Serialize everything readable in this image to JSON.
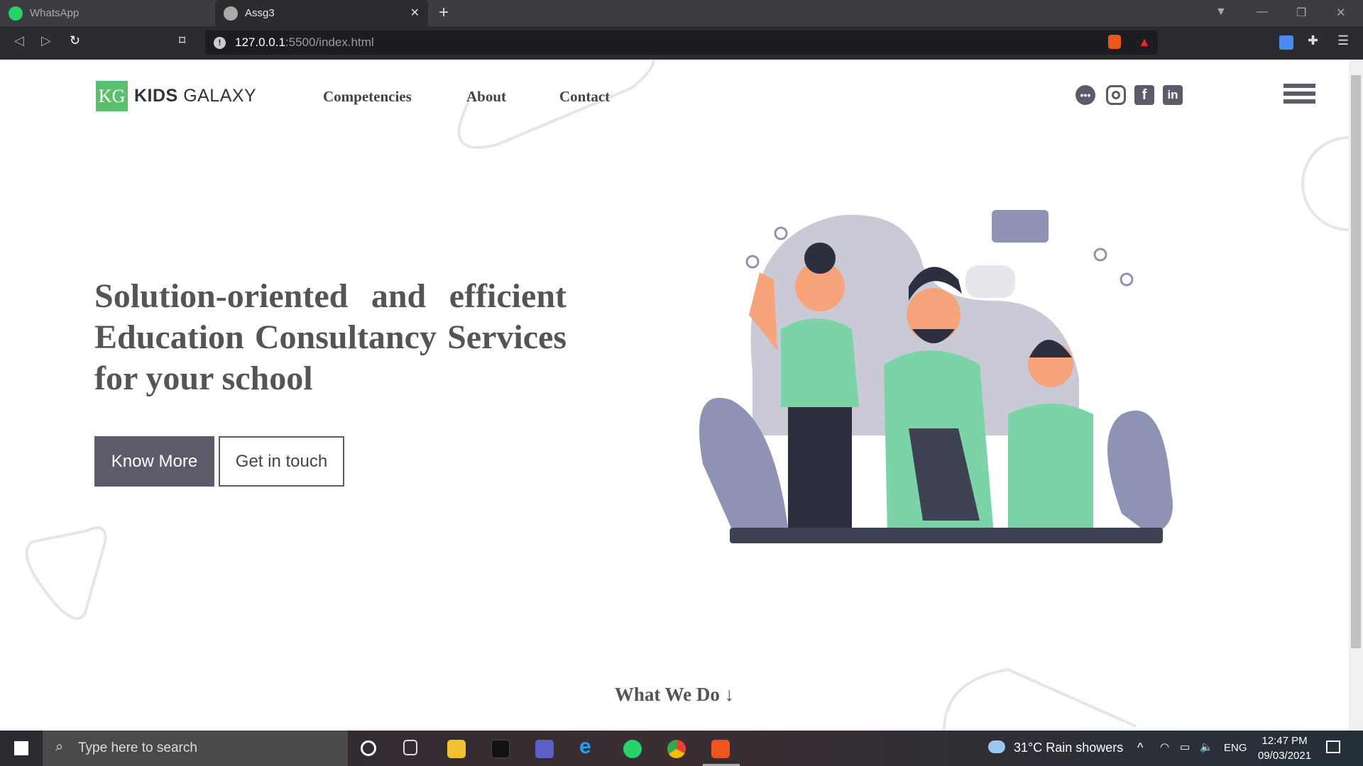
{
  "browser": {
    "tabs": [
      {
        "title": "WhatsApp"
      },
      {
        "title": "Assg3"
      }
    ],
    "url_host": "127.0.0.1",
    "url_rest": ":5500/index.html"
  },
  "header": {
    "logo_mark": "KG",
    "logo_bold": "KIDS",
    "logo_light": "GALAXY",
    "nav": [
      "Competencies",
      "About",
      "Contact"
    ]
  },
  "hero": {
    "heading": "Solution-oriented and efficient Education Consultancy Services for your school",
    "primary_button": "Know More",
    "secondary_button": "Get in touch"
  },
  "section": {
    "what_we_do": "What We Do"
  },
  "taskbar": {
    "search_placeholder": "Type here to search",
    "weather": "31°C  Rain showers",
    "lang": "ENG",
    "time": "12:47 PM",
    "date": "09/03/2021"
  },
  "colors": {
    "accent": "#5e5a6a",
    "logo_green": "#5cbf6f",
    "illustration_green": "#7dd3a8"
  }
}
